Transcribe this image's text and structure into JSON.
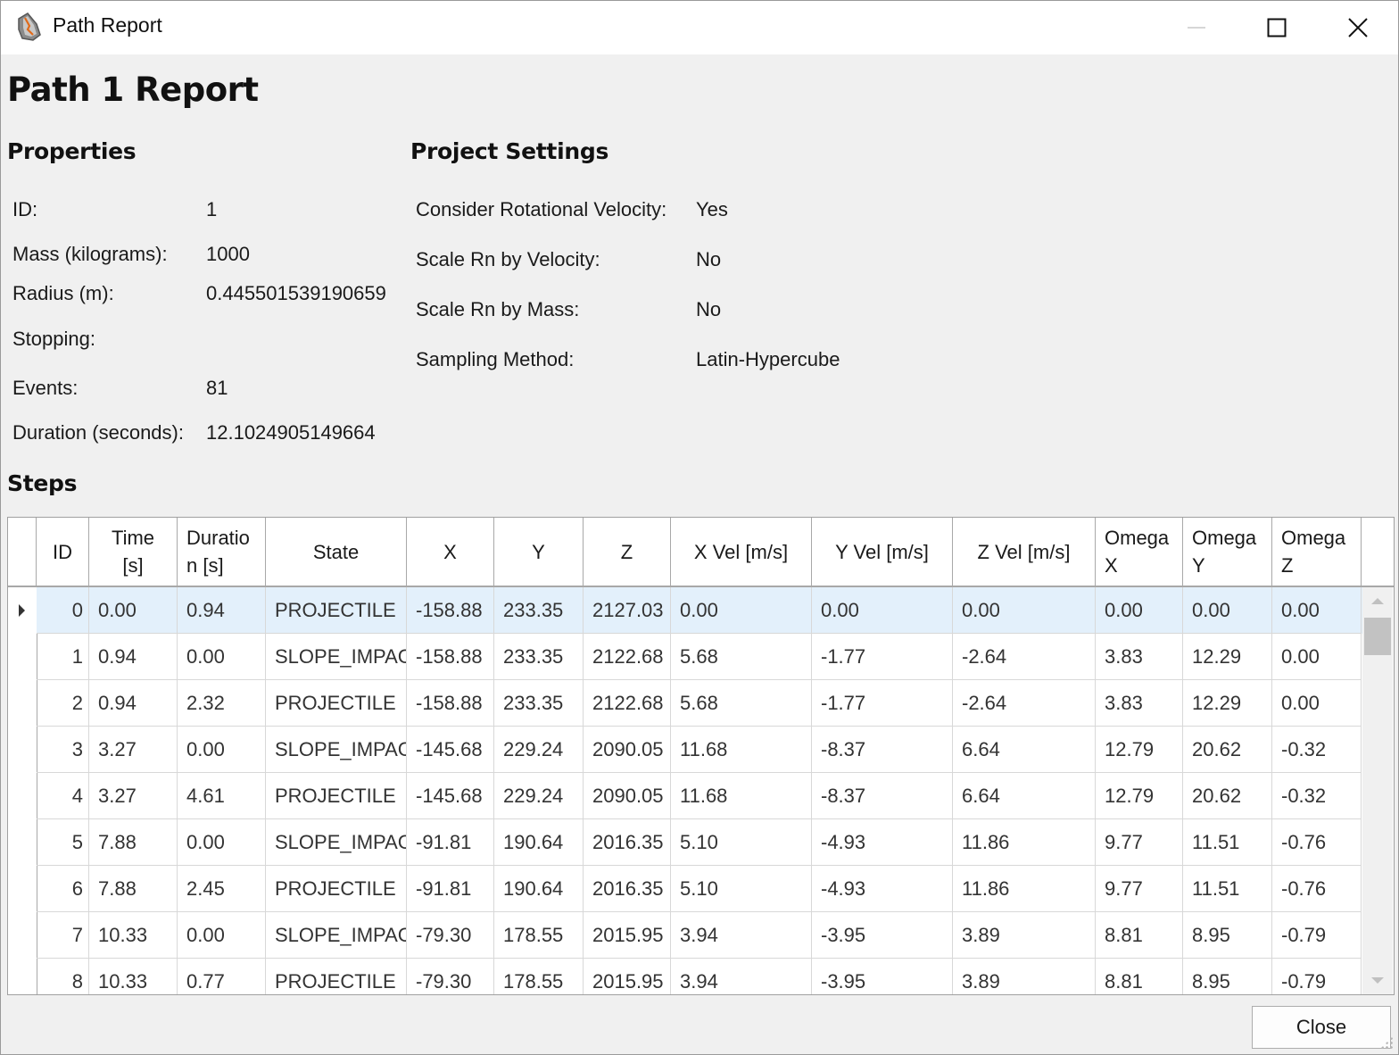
{
  "window": {
    "title": "Path Report",
    "controls": {
      "minimize": "minimize",
      "maximize": "maximize",
      "close": "close"
    }
  },
  "report": {
    "heading": "Path 1 Report",
    "properties": {
      "title": "Properties",
      "items": [
        {
          "label": "ID:",
          "value": "1"
        },
        {
          "label": "Mass (kilograms):",
          "value": "1000"
        },
        {
          "label": "Radius (m):",
          "value": "0.445501539190659"
        },
        {
          "label": "Stopping:",
          "value": ""
        },
        {
          "label": "Events:",
          "value": "81"
        },
        {
          "label": "Duration (seconds):",
          "value": "12.1024905149664"
        }
      ]
    },
    "project_settings": {
      "title": "Project Settings",
      "items": [
        {
          "label": "Consider Rotational Velocity:",
          "value": "Yes"
        },
        {
          "label": "Scale Rn by Velocity:",
          "value": "No"
        },
        {
          "label": "Scale Rn by Mass:",
          "value": "No"
        },
        {
          "label": "Sampling Method:",
          "value": "Latin-Hypercube"
        }
      ]
    },
    "steps": {
      "title": "Steps",
      "columns": [
        "ID",
        "Time [s]",
        "Duration [s]",
        "State",
        "X",
        "Y",
        "Z",
        "X Vel [m/s]",
        "Y Vel [m/s]",
        "Z Vel [m/s]",
        "Omega X",
        "Omega Y",
        "Omega Z"
      ],
      "column_display": [
        "ID",
        "Time\n[s]",
        "Duratio\nn [s]",
        "State",
        "X",
        "Y",
        "Z",
        "X Vel [m/s]",
        "Y Vel [m/s]",
        "Z Vel [m/s]",
        "Omega\nX",
        "Omega\nY",
        "Omega\nZ"
      ],
      "selected_row": 0,
      "rows": [
        [
          "0",
          "0.00",
          "0.94",
          "PROJECTILE",
          "-158.88",
          "233.35",
          "2127.03",
          "0.00",
          "0.00",
          "0.00",
          "0.00",
          "0.00",
          "0.00"
        ],
        [
          "1",
          "0.94",
          "0.00",
          "SLOPE_IMPAC",
          "-158.88",
          "233.35",
          "2122.68",
          "5.68",
          "-1.77",
          "-2.64",
          "3.83",
          "12.29",
          "0.00"
        ],
        [
          "2",
          "0.94",
          "2.32",
          "PROJECTILE",
          "-158.88",
          "233.35",
          "2122.68",
          "5.68",
          "-1.77",
          "-2.64",
          "3.83",
          "12.29",
          "0.00"
        ],
        [
          "3",
          "3.27",
          "0.00",
          "SLOPE_IMPAC",
          "-145.68",
          "229.24",
          "2090.05",
          "11.68",
          "-8.37",
          "6.64",
          "12.79",
          "20.62",
          "-0.32"
        ],
        [
          "4",
          "3.27",
          "4.61",
          "PROJECTILE",
          "-145.68",
          "229.24",
          "2090.05",
          "11.68",
          "-8.37",
          "6.64",
          "12.79",
          "20.62",
          "-0.32"
        ],
        [
          "5",
          "7.88",
          "0.00",
          "SLOPE_IMPAC",
          "-91.81",
          "190.64",
          "2016.35",
          "5.10",
          "-4.93",
          "11.86",
          "9.77",
          "11.51",
          "-0.76"
        ],
        [
          "6",
          "7.88",
          "2.45",
          "PROJECTILE",
          "-91.81",
          "190.64",
          "2016.35",
          "5.10",
          "-4.93",
          "11.86",
          "9.77",
          "11.51",
          "-0.76"
        ],
        [
          "7",
          "10.33",
          "0.00",
          "SLOPE_IMPAC",
          "-79.30",
          "178.55",
          "2015.95",
          "3.94",
          "-3.95",
          "3.89",
          "8.81",
          "8.95",
          "-0.79"
        ],
        [
          "8",
          "10.33",
          "0.77",
          "PROJECTILE",
          "-79.30",
          "178.55",
          "2015.95",
          "3.94",
          "-3.95",
          "3.89",
          "8.81",
          "8.95",
          "-0.79"
        ]
      ]
    }
  },
  "buttons": {
    "close": "Close"
  }
}
